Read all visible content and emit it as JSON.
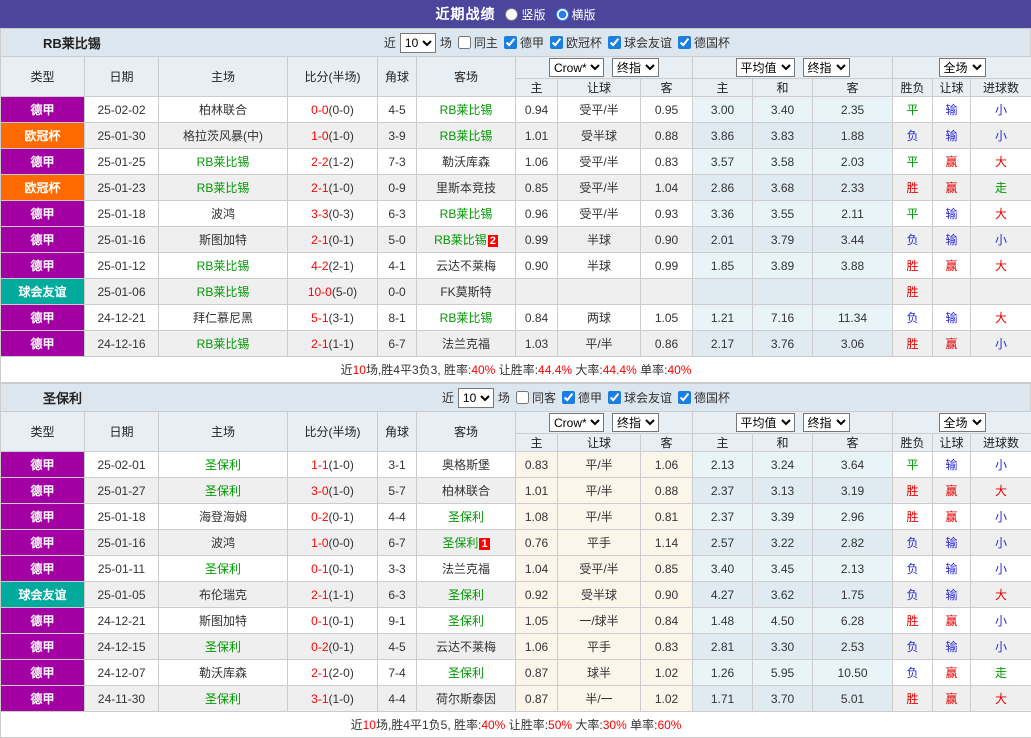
{
  "header": {
    "title": "近期战绩",
    "radios": [
      {
        "label": "竖版",
        "checked": false
      },
      {
        "label": "横版",
        "checked": true
      }
    ]
  },
  "dropdowns": {
    "crow": "Crow*",
    "crow_stage": "终指",
    "avg": "平均值",
    "avg_stage": "终指",
    "scope": "全场"
  },
  "table_headers": {
    "left": [
      "类型",
      "日期",
      "主场",
      "比分(半场)",
      "角球",
      "客场"
    ],
    "sub": [
      "主",
      "让球",
      "客",
      "主",
      "和",
      "客",
      "胜负",
      "让球",
      "进球数"
    ]
  },
  "league_colors": {
    "德甲": "#a300a3",
    "欧冠杯": "#ff6a00",
    "球会友谊": "#00ab9e"
  },
  "result_colors": {
    "胜": "#e60000",
    "负": "#2a2ad2",
    "平": "#009900",
    "赢": "#e60000",
    "输": "#2a2ad2",
    "走": "#009900",
    "大": "#e60000",
    "小": "#2a2ad2"
  },
  "accent": {
    "topbar_bg": "#4b469b",
    "focus_team": "#009900",
    "score_red": "#ff0000",
    "badge_num_bg": "#ff0000"
  },
  "tables": [
    {
      "team": "RB莱比锡",
      "controls": {
        "prefix": "近",
        "count": "10",
        "suffix": "场",
        "same": "同主",
        "leagues": [
          "德甲",
          "欧冠杯",
          "球会友谊",
          "德国杯"
        ]
      },
      "rows": [
        {
          "league": "德甲",
          "date": "25-02-02",
          "home": "柏林联合",
          "home_focus": false,
          "home_badge": "",
          "score": "0-0",
          "half": "(0-0)",
          "corner": "4-5",
          "away": "RB莱比锡",
          "away_focus": true,
          "away_badge": "",
          "crow_home": "0.94",
          "handicap": "受平/半",
          "crow_away": "0.95",
          "avg_home": "3.00",
          "avg_draw": "3.40",
          "avg_away": "2.35",
          "res_outcome": "平",
          "res_handicap": "输",
          "res_goals": "小"
        },
        {
          "league": "欧冠杯",
          "date": "25-01-30",
          "home": "格拉茨风暴(中)",
          "home_focus": false,
          "home_badge": "",
          "score": "1-0",
          "half": "(1-0)",
          "corner": "3-9",
          "away": "RB莱比锡",
          "away_focus": true,
          "away_badge": "",
          "crow_home": "1.01",
          "handicap": "受半球",
          "crow_away": "0.88",
          "avg_home": "3.86",
          "avg_draw": "3.83",
          "avg_away": "1.88",
          "res_outcome": "负",
          "res_handicap": "输",
          "res_goals": "小"
        },
        {
          "league": "德甲",
          "date": "25-01-25",
          "home": "RB莱比锡",
          "home_focus": true,
          "home_badge": "",
          "score": "2-2",
          "half": "(1-2)",
          "corner": "7-3",
          "away": "勒沃库森",
          "away_focus": false,
          "away_badge": "",
          "crow_home": "1.06",
          "handicap": "受平/半",
          "crow_away": "0.83",
          "avg_home": "3.57",
          "avg_draw": "3.58",
          "avg_away": "2.03",
          "res_outcome": "平",
          "res_handicap": "赢",
          "res_goals": "大"
        },
        {
          "league": "欧冠杯",
          "date": "25-01-23",
          "home": "RB莱比锡",
          "home_focus": true,
          "home_badge": "",
          "score": "2-1",
          "half": "(1-0)",
          "corner": "0-9",
          "away": "里斯本竞技",
          "away_focus": false,
          "away_badge": "",
          "crow_home": "0.85",
          "handicap": "受平/半",
          "crow_away": "1.04",
          "avg_home": "2.86",
          "avg_draw": "3.68",
          "avg_away": "2.33",
          "res_outcome": "胜",
          "res_handicap": "赢",
          "res_goals": "走"
        },
        {
          "league": "德甲",
          "date": "25-01-18",
          "home": "波鸿",
          "home_focus": false,
          "home_badge": "",
          "score": "3-3",
          "half": "(0-3)",
          "corner": "6-3",
          "away": "RB莱比锡",
          "away_focus": true,
          "away_badge": "",
          "crow_home": "0.96",
          "handicap": "受平/半",
          "crow_away": "0.93",
          "avg_home": "3.36",
          "avg_draw": "3.55",
          "avg_away": "2.11",
          "res_outcome": "平",
          "res_handicap": "输",
          "res_goals": "大"
        },
        {
          "league": "德甲",
          "date": "25-01-16",
          "home": "斯图加特",
          "home_focus": false,
          "home_badge": "",
          "score": "2-1",
          "half": "(0-1)",
          "corner": "5-0",
          "away": "RB莱比锡",
          "away_focus": true,
          "away_badge": "2",
          "crow_home": "0.99",
          "handicap": "半球",
          "crow_away": "0.90",
          "avg_home": "2.01",
          "avg_draw": "3.79",
          "avg_away": "3.44",
          "res_outcome": "负",
          "res_handicap": "输",
          "res_goals": "小"
        },
        {
          "league": "德甲",
          "date": "25-01-12",
          "home": "RB莱比锡",
          "home_focus": true,
          "home_badge": "",
          "score": "4-2",
          "half": "(2-1)",
          "corner": "4-1",
          "away": "云达不莱梅",
          "away_focus": false,
          "away_badge": "",
          "crow_home": "0.90",
          "handicap": "半球",
          "crow_away": "0.99",
          "avg_home": "1.85",
          "avg_draw": "3.89",
          "avg_away": "3.88",
          "res_outcome": "胜",
          "res_handicap": "赢",
          "res_goals": "大"
        },
        {
          "league": "球会友谊",
          "date": "25-01-06",
          "home": "RB莱比锡",
          "home_focus": true,
          "home_badge": "",
          "score": "10-0",
          "half": "(5-0)",
          "corner": "0-0",
          "away": "FK莫斯特",
          "away_focus": false,
          "away_badge": "",
          "crow_home": "",
          "handicap": "",
          "crow_away": "",
          "avg_home": "",
          "avg_draw": "",
          "avg_away": "",
          "res_outcome": "胜",
          "res_handicap": "",
          "res_goals": ""
        },
        {
          "league": "德甲",
          "date": "24-12-21",
          "home": "拜仁慕尼黑",
          "home_focus": false,
          "home_badge": "",
          "score": "5-1",
          "half": "(3-1)",
          "corner": "8-1",
          "away": "RB莱比锡",
          "away_focus": true,
          "away_badge": "",
          "crow_home": "0.84",
          "handicap": "两球",
          "crow_away": "1.05",
          "avg_home": "1.21",
          "avg_draw": "7.16",
          "avg_away": "11.34",
          "res_outcome": "负",
          "res_handicap": "输",
          "res_goals": "大"
        },
        {
          "league": "德甲",
          "date": "24-12-16",
          "home": "RB莱比锡",
          "home_focus": true,
          "home_badge": "",
          "score": "2-1",
          "half": "(1-1)",
          "corner": "6-7",
          "away": "法兰克福",
          "away_focus": false,
          "away_badge": "",
          "crow_home": "1.03",
          "handicap": "平/半",
          "crow_away": "0.86",
          "avg_home": "2.17",
          "avg_draw": "3.76",
          "avg_away": "3.06",
          "res_outcome": "胜",
          "res_handicap": "赢",
          "res_goals": "小"
        }
      ],
      "summary": [
        [
          "近",
          0
        ],
        [
          "10",
          1
        ],
        [
          "场,胜4平3负3, 胜率:",
          0
        ],
        [
          "40%",
          1
        ],
        [
          " 让胜率:",
          0
        ],
        [
          "44.4%",
          1
        ],
        [
          " 大率:",
          0
        ],
        [
          "44.4%",
          1
        ],
        [
          " 单率:",
          0
        ],
        [
          "40%",
          1
        ]
      ]
    },
    {
      "team": "圣保利",
      "controls": {
        "prefix": "近",
        "count": "10",
        "suffix": "场",
        "same": "同客",
        "leagues": [
          "德甲",
          "球会友谊",
          "德国杯"
        ]
      },
      "rows": [
        {
          "league": "德甲",
          "date": "25-02-01",
          "home": "圣保利",
          "home_focus": true,
          "home_badge": "",
          "score": "1-1",
          "half": "(1-0)",
          "corner": "3-1",
          "away": "奥格斯堡",
          "away_focus": false,
          "away_badge": "",
          "crow_home": "0.83",
          "handicap": "平/半",
          "crow_away": "1.06",
          "avg_home": "2.13",
          "avg_draw": "3.24",
          "avg_away": "3.64",
          "res_outcome": "平",
          "res_handicap": "输",
          "res_goals": "小"
        },
        {
          "league": "德甲",
          "date": "25-01-27",
          "home": "圣保利",
          "home_focus": true,
          "home_badge": "",
          "score": "3-0",
          "half": "(1-0)",
          "corner": "5-7",
          "away": "柏林联合",
          "away_focus": false,
          "away_badge": "",
          "crow_home": "1.01",
          "handicap": "平/半",
          "crow_away": "0.88",
          "avg_home": "2.37",
          "avg_draw": "3.13",
          "avg_away": "3.19",
          "res_outcome": "胜",
          "res_handicap": "赢",
          "res_goals": "大"
        },
        {
          "league": "德甲",
          "date": "25-01-18",
          "home": "海登海姆",
          "home_focus": false,
          "home_badge": "",
          "score": "0-2",
          "half": "(0-1)",
          "corner": "4-4",
          "away": "圣保利",
          "away_focus": true,
          "away_badge": "",
          "crow_home": "1.08",
          "handicap": "平/半",
          "crow_away": "0.81",
          "avg_home": "2.37",
          "avg_draw": "3.39",
          "avg_away": "2.96",
          "res_outcome": "胜",
          "res_handicap": "赢",
          "res_goals": "小"
        },
        {
          "league": "德甲",
          "date": "25-01-16",
          "home": "波鸿",
          "home_focus": false,
          "home_badge": "",
          "score": "1-0",
          "half": "(0-0)",
          "corner": "6-7",
          "away": "圣保利",
          "away_focus": true,
          "away_badge": "1",
          "crow_home": "0.76",
          "handicap": "平手",
          "crow_away": "1.14",
          "avg_home": "2.57",
          "avg_draw": "3.22",
          "avg_away": "2.82",
          "res_outcome": "负",
          "res_handicap": "输",
          "res_goals": "小"
        },
        {
          "league": "德甲",
          "date": "25-01-11",
          "home": "圣保利",
          "home_focus": true,
          "home_badge": "",
          "score": "0-1",
          "half": "(0-1)",
          "corner": "3-3",
          "away": "法兰克福",
          "away_focus": false,
          "away_badge": "",
          "crow_home": "1.04",
          "handicap": "受平/半",
          "crow_away": "0.85",
          "avg_home": "3.40",
          "avg_draw": "3.45",
          "avg_away": "2.13",
          "res_outcome": "负",
          "res_handicap": "输",
          "res_goals": "小"
        },
        {
          "league": "球会友谊",
          "date": "25-01-05",
          "home": "布伦瑞克",
          "home_focus": false,
          "home_badge": "",
          "score": "2-1",
          "half": "(1-1)",
          "corner": "6-3",
          "away": "圣保利",
          "away_focus": true,
          "away_badge": "",
          "crow_home": "0.92",
          "handicap": "受半球",
          "crow_away": "0.90",
          "avg_home": "4.27",
          "avg_draw": "3.62",
          "avg_away": "1.75",
          "res_outcome": "负",
          "res_handicap": "输",
          "res_goals": "大"
        },
        {
          "league": "德甲",
          "date": "24-12-21",
          "home": "斯图加特",
          "home_focus": false,
          "home_badge": "",
          "score": "0-1",
          "half": "(0-1)",
          "corner": "9-1",
          "away": "圣保利",
          "away_focus": true,
          "away_badge": "",
          "crow_home": "1.05",
          "handicap": "一/球半",
          "crow_away": "0.84",
          "avg_home": "1.48",
          "avg_draw": "4.50",
          "avg_away": "6.28",
          "res_outcome": "胜",
          "res_handicap": "赢",
          "res_goals": "小"
        },
        {
          "league": "德甲",
          "date": "24-12-15",
          "home": "圣保利",
          "home_focus": true,
          "home_badge": "",
          "score": "0-2",
          "half": "(0-1)",
          "corner": "4-5",
          "away": "云达不莱梅",
          "away_focus": false,
          "away_badge": "",
          "crow_home": "1.06",
          "handicap": "平手",
          "crow_away": "0.83",
          "avg_home": "2.81",
          "avg_draw": "3.30",
          "avg_away": "2.53",
          "res_outcome": "负",
          "res_handicap": "输",
          "res_goals": "小"
        },
        {
          "league": "德甲",
          "date": "24-12-07",
          "home": "勒沃库森",
          "home_focus": false,
          "home_badge": "",
          "score": "2-1",
          "half": "(2-0)",
          "corner": "7-4",
          "away": "圣保利",
          "away_focus": true,
          "away_badge": "",
          "crow_home": "0.87",
          "handicap": "球半",
          "crow_away": "1.02",
          "avg_home": "1.26",
          "avg_draw": "5.95",
          "avg_away": "10.50",
          "res_outcome": "负",
          "res_handicap": "赢",
          "res_goals": "走"
        },
        {
          "league": "德甲",
          "date": "24-11-30",
          "home": "圣保利",
          "home_focus": true,
          "home_badge": "",
          "score": "3-1",
          "half": "(1-0)",
          "corner": "4-4",
          "away": "荷尔斯泰因",
          "away_focus": false,
          "away_badge": "",
          "crow_home": "0.87",
          "handicap": "半/一",
          "crow_away": "1.02",
          "avg_home": "1.71",
          "avg_draw": "3.70",
          "avg_away": "5.01",
          "res_outcome": "胜",
          "res_handicap": "赢",
          "res_goals": "大"
        }
      ],
      "summary": [
        [
          "近",
          0
        ],
        [
          "10",
          1
        ],
        [
          "场,胜4平1负5, 胜率:",
          0
        ],
        [
          "40%",
          1
        ],
        [
          " 让胜率:",
          0
        ],
        [
          "50%",
          1
        ],
        [
          " 大率:",
          0
        ],
        [
          "30%",
          1
        ],
        [
          " 单率:",
          0
        ],
        [
          "60%",
          1
        ]
      ]
    }
  ]
}
